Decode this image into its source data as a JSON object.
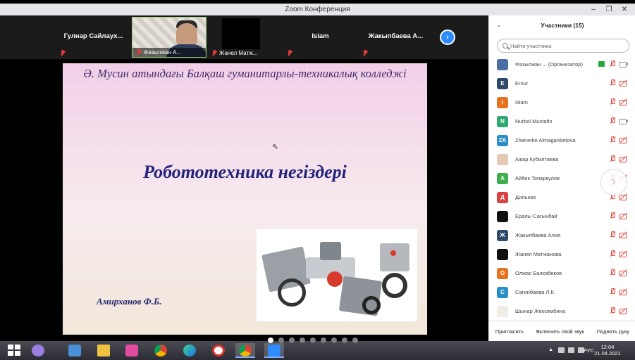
{
  "window": {
    "title": "Zoom Конференция",
    "minimize": "–",
    "maximize": "❐",
    "close": "✕"
  },
  "gallery": {
    "tiles": [
      {
        "name": "Гулнар  Сайлаух..."
      },
      {
        "caption": "Фазылжан А..."
      },
      {
        "caption": "Жанел Матж..."
      },
      {
        "name": "Islam"
      },
      {
        "name": "Жакыпбаева  А..."
      }
    ],
    "next_glyph": "›"
  },
  "slide": {
    "college": "Ә. Мусин атындағы Балқаш гуманитарлы-техникалық колледжі",
    "topic": "Робототехника негіздері",
    "author": "Амирханов Ф.Б."
  },
  "panel": {
    "title": "Участники (15)",
    "search_placeholder": "Найти участника",
    "scroll_glyph": "›",
    "participants": [
      {
        "initial": "",
        "name": "Фазылжан ...  (Организатор)",
        "color": "#4a6fa5",
        "cam": "on",
        "host": true
      },
      {
        "initial": "E",
        "name": "Ernur",
        "color": "#2f4a6a",
        "cam": "off"
      },
      {
        "initial": "I",
        "name": "Islam",
        "color": "#e8731f",
        "cam": "off"
      },
      {
        "initial": "N",
        "name": "Nurbol Mustafin",
        "color": "#2eaa6e",
        "cam": "on"
      },
      {
        "initial": "ZA",
        "name": "Zhanerke Almaganbetova",
        "color": "#2a8fc8",
        "cam": "off"
      },
      {
        "initial": "",
        "name": "Ажар Кубилтаева",
        "color": "#e7c8b5",
        "cam": "off"
      },
      {
        "initial": "А",
        "name": "Айбек Топаркулов",
        "color": "#3fae4c",
        "cam": "off"
      },
      {
        "initial": "Д",
        "name": "Дильназ",
        "color": "#d94040",
        "cam": "off"
      },
      {
        "initial": "",
        "name": "Ералы Сагынбай",
        "color": "#111111",
        "cam": "off"
      },
      {
        "initial": "Ж",
        "name": "Жакыпбаева Алия",
        "color": "#2f4a6a",
        "cam": "off"
      },
      {
        "initial": "",
        "name": "Жанел Матжанова",
        "color": "#111111",
        "cam": "off"
      },
      {
        "initial": "О",
        "name": "Олжас Балкабеков",
        "color": "#e8731f",
        "cam": "off"
      },
      {
        "initial": "С",
        "name": "Сагинбаева Л.К.",
        "color": "#2a8fc8",
        "cam": "off"
      },
      {
        "initial": "",
        "name": "Шынар Жексембина",
        "color": "#f1ede6",
        "cam": "off"
      }
    ],
    "footer": {
      "invite": "Пригласить",
      "unmute": "Включить свой звук",
      "raise_hand": "Поднять руку"
    }
  },
  "taskbar": {
    "language": "РУС",
    "time": "12:04",
    "date": "21.04.2021",
    "tray_arrow": "▲"
  }
}
